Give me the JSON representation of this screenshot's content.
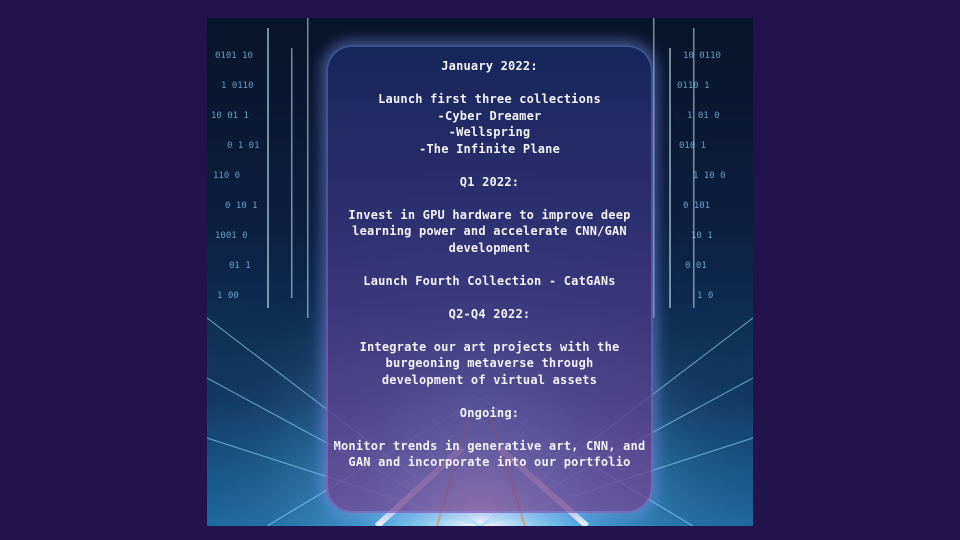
{
  "roadmap": {
    "jan_heading": "January 2022:",
    "jan_line1": "Launch first three collections",
    "jan_line2": "-Cyber Dreamer",
    "jan_line3": "-Wellspring",
    "jan_line4": "-The Infinite Plane",
    "q1_heading": "Q1 2022:",
    "q1_line1": "Invest in GPU hardware to improve deep",
    "q1_line2": "learning power and accelerate CNN/GAN",
    "q1_line3": "development",
    "q1_line4": "Launch Fourth Collection - CatGANs",
    "q2_heading": "Q2-Q4 2022:",
    "q2_line1": "Integrate our art projects with the",
    "q2_line2": "burgeoning metaverse through",
    "q2_line3": "development of virtual assets",
    "ongoing_heading": "Ongoing:",
    "ongoing_line1": "Monitor trends in generative art, CNN, and",
    "ongoing_line2": "GAN and incorporate into our portfolio"
  },
  "colors": {
    "slide_background": "#22134f",
    "panel_top": "#16285f",
    "panel_bottom": "#734896",
    "text": "#f2f2f8"
  }
}
